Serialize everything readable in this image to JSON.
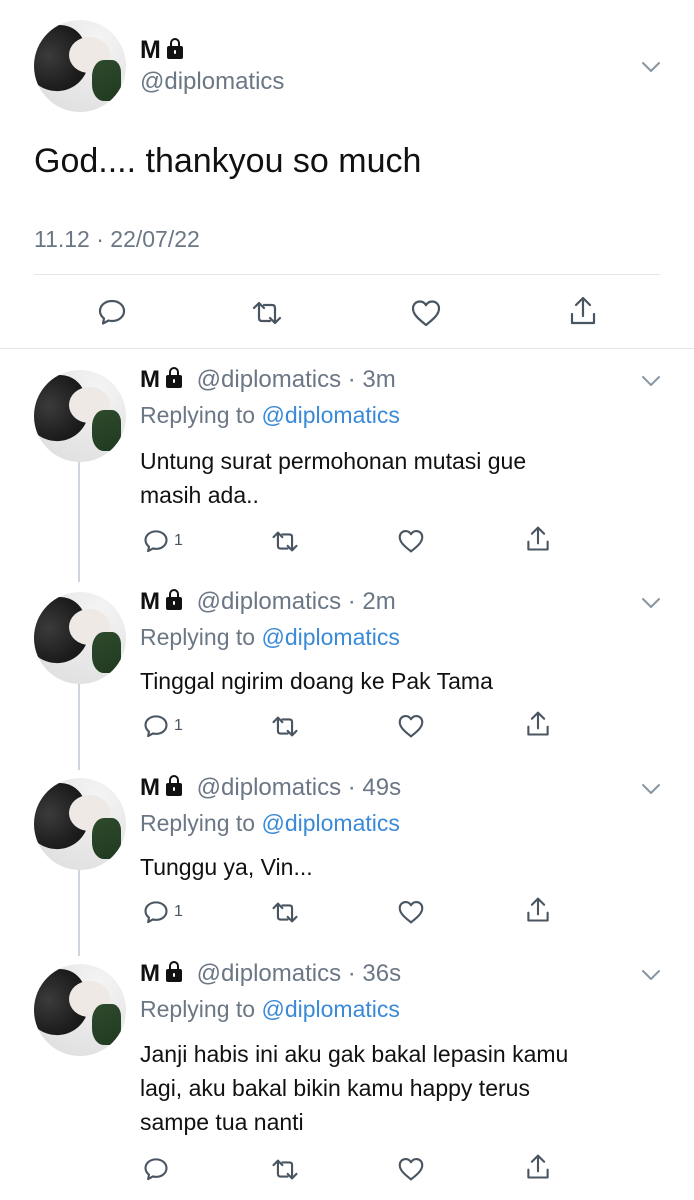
{
  "main_tweet": {
    "name": "M",
    "handle": "@diplomatics",
    "text": "God.... thankyou so much",
    "timestamp": "11.12 · 22/07/22",
    "actions": [
      "comment-icon",
      "retweet-icon",
      "like-icon",
      "share-icon"
    ]
  },
  "replies": [
    {
      "name": "M",
      "handle": "@diplomatics",
      "time": "· 3m",
      "replying_prefix": "Replying to",
      "replying_handle": "@diplomatics",
      "text_lines": [
        "Untung surat permohonan mutasi gue",
        "masih ada.."
      ],
      "reply_count": "1"
    },
    {
      "name": "M",
      "handle": "@diplomatics",
      "time": "· 2m",
      "replying_prefix": "Replying to",
      "replying_handle": "@diplomatics",
      "text_lines": [
        "Tinggal ngirim doang ke Pak Tama"
      ],
      "reply_count": "1"
    },
    {
      "name": "M",
      "handle": "@diplomatics",
      "time": "· 49s",
      "replying_prefix": "Replying to",
      "replying_handle": "@diplomatics",
      "text_lines": [
        "Tunggu ya, Vin..."
      ],
      "reply_count": "1"
    },
    {
      "name": "M",
      "handle": "@diplomatics",
      "time": "· 36s",
      "replying_prefix": "Replying to",
      "replying_handle": "@diplomatics",
      "text_lines": [
        "Janji habis ini aku gak bakal lepasin kamu",
        "lagi, aku bakal bikin kamu happy terus",
        "sampe tua nanti"
      ],
      "reply_count": ""
    }
  ],
  "colors": {
    "link": "#3a8ad8",
    "muted": "#6b7785",
    "icon": "#4a5562",
    "divider": "#e3e6ea"
  }
}
